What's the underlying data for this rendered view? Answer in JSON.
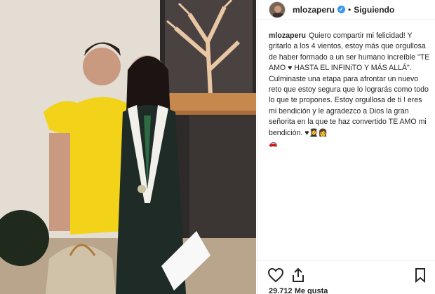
{
  "post": {
    "username": "mlozaperu",
    "follow_label": "Siguiendo",
    "separator": "•",
    "caption_user": "mlozaperu",
    "caption_text": "Quiero compartir mi felicidad! Y gritarlo a los 4 vientos, estoy más que orgullosa de haber formado a un ser humano increíble \"TE AMO ♥ HASTA EL INFINiTO Y MÁS ALLÁ\". Culminaste una etapa para afrontar un nuevo reto que estoy segura que lo lograrás como todo lo que te propones. Estoy orgullosa de ti ! eres mi bendición y le agradezco a Dios la gran señorita en la que te haz convertido TE AMO mi bendición. ♥👩‍🎓👩",
    "caption_extra_emoji": "🚗",
    "likes": "29.712 Me gusta"
  },
  "icons": {
    "verified": "verified-badge-icon",
    "like": "heart-icon",
    "share": "share-icon",
    "save": "bookmark-icon"
  },
  "colors": {
    "verified": "#3897f0",
    "text": "#262626",
    "border": "#efefef"
  }
}
